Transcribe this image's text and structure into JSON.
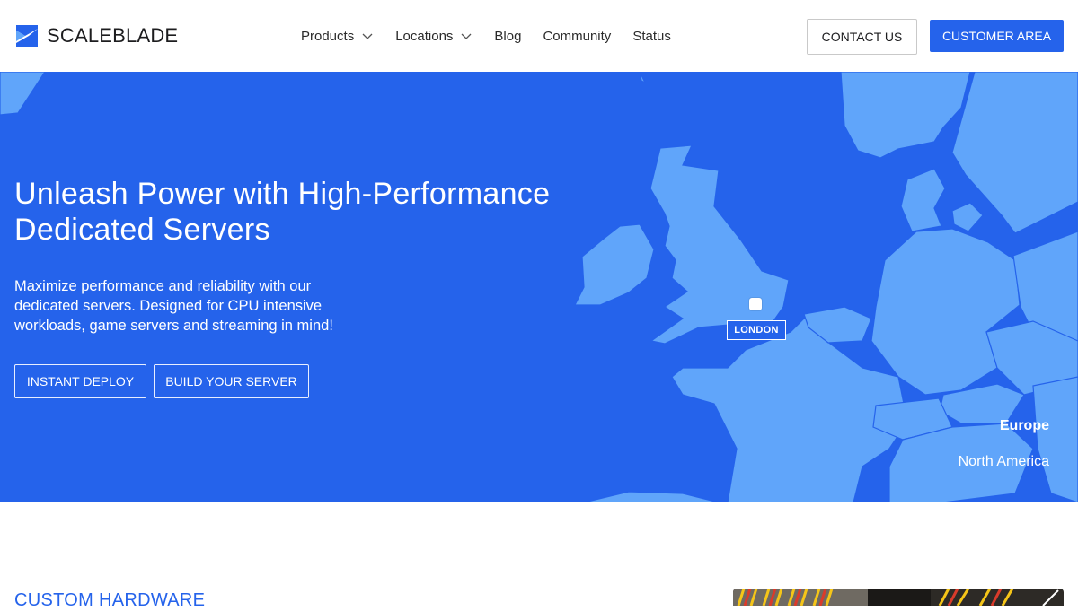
{
  "brand": {
    "name": "SCALEBLADE"
  },
  "nav": [
    {
      "label": "Products",
      "has_dropdown": true
    },
    {
      "label": "Locations",
      "has_dropdown": true
    },
    {
      "label": "Blog",
      "has_dropdown": false
    },
    {
      "label": "Community",
      "has_dropdown": false
    },
    {
      "label": "Status",
      "has_dropdown": false
    }
  ],
  "header_actions": {
    "contact_label": "CONTACT US",
    "customer_label": "CUSTOMER AREA"
  },
  "hero": {
    "title_line1": "Unleash Power with High-Performance",
    "title_line2": "Dedicated Servers",
    "description": "Maximize performance and reliability with our dedicated servers. Designed for CPU intensive workloads, game servers and streaming in mind!",
    "instant_label": "INSTANT DEPLOY",
    "build_label": "BUILD YOUR SERVER",
    "map": {
      "pin_label": "LONDON",
      "regions": [
        {
          "label": "Europe",
          "active": true
        },
        {
          "label": "North America",
          "active": false
        }
      ]
    }
  },
  "section": {
    "title": "CUSTOM HARDWARE"
  },
  "colors": {
    "accent": "#2563eb",
    "land": "#60a5fa",
    "white": "#ffffff"
  },
  "icons": [
    "scaleblade-logo-icon",
    "chevron-down-icon"
  ]
}
